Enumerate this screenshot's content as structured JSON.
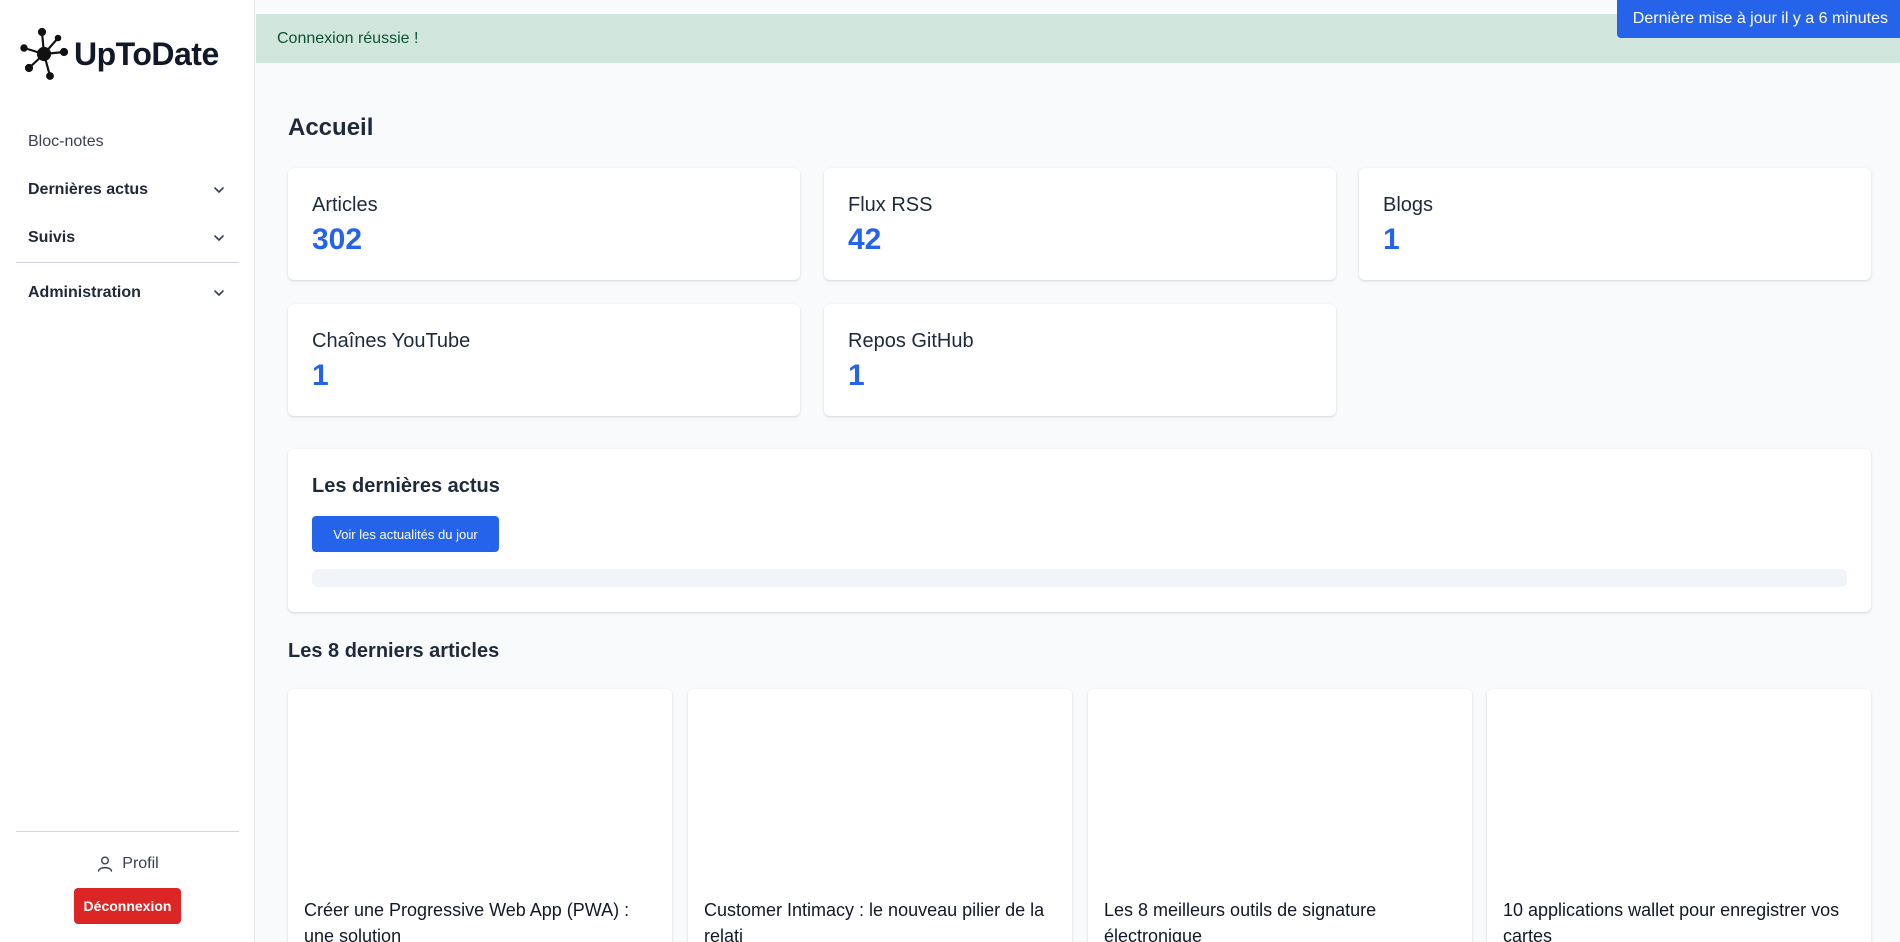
{
  "app": {
    "name": "UpToDate"
  },
  "sidebar": {
    "items": [
      {
        "label": "Bloc-notes",
        "has_chevron": false
      },
      {
        "label": "Dernières actus",
        "has_chevron": true
      },
      {
        "label": "Suivis",
        "has_chevron": true
      },
      {
        "label": "Administration",
        "has_chevron": true
      }
    ],
    "profile_label": "Profil",
    "logout_label": "Déconnexion"
  },
  "alert": {
    "message": "Connexion réussie !"
  },
  "update_badge": "Dernière mise à jour il y a 6 minutes",
  "page_title": "Accueil",
  "stats": [
    {
      "label": "Articles",
      "value": "302"
    },
    {
      "label": "Flux RSS",
      "value": "42"
    },
    {
      "label": "Blogs",
      "value": "1"
    },
    {
      "label": "Chaînes YouTube",
      "value": "1"
    },
    {
      "label": "Repos GitHub",
      "value": "1"
    }
  ],
  "latest_news": {
    "title": "Les dernières actus",
    "button_label": "Voir les actualités du jour"
  },
  "articles_section": {
    "title": "Les 8 derniers articles",
    "articles": [
      {
        "title": "Créer une Progressive Web App (PWA) : une solution"
      },
      {
        "title": "Customer Intimacy : le nouveau pilier de la relati"
      },
      {
        "title": "Les 8 meilleurs outils de signature électronique"
      },
      {
        "title": "10 applications wallet pour enregistrer vos cartes"
      }
    ]
  },
  "colors": {
    "primary": "#2563eb",
    "danger": "#dc2626",
    "success_bg": "#d1e7dd",
    "success_text": "#0f5132"
  },
  "icons": {
    "logo": "molecule-logo-icon",
    "chevron": "chevron-down-icon",
    "profile": "user-icon"
  }
}
